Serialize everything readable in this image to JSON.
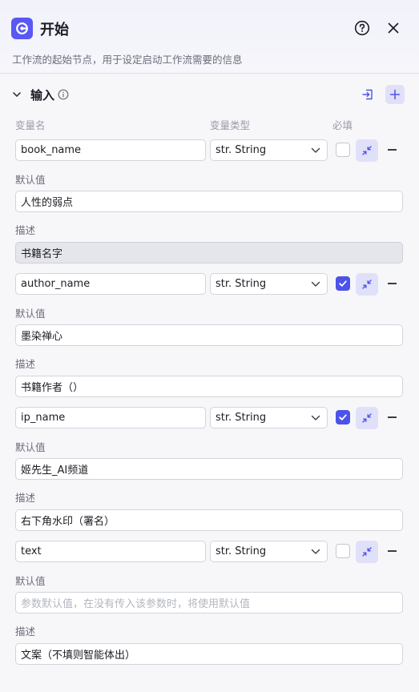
{
  "header": {
    "title": "开始",
    "subtitle": "工作流的起始节点，用于设定启动工作流需要的信息",
    "logo_icon": "start-node-icon",
    "help_icon": "help-circle-icon",
    "close_icon": "close-icon"
  },
  "section": {
    "title": "输入",
    "columns": {
      "name": "变量名",
      "type": "变量类型",
      "required": "必填"
    }
  },
  "labels": {
    "default": "默认值",
    "desc": "描述"
  },
  "accent_color": "#4d53e8",
  "variables": [
    {
      "name": "book_name",
      "type": "str. String",
      "required": false,
      "default": "人性的弱点",
      "default_placeholder": "",
      "desc": "书籍名字"
    },
    {
      "name": "author_name",
      "type": "str. String",
      "required": true,
      "default": "墨染禅心",
      "default_placeholder": "",
      "desc": "书籍作者（）"
    },
    {
      "name": "ip_name",
      "type": "str. String",
      "required": true,
      "default": "姬先生_AI频道",
      "default_placeholder": "",
      "desc": "右下角水印（署名）"
    },
    {
      "name": "text",
      "type": "str. String",
      "required": false,
      "default": "",
      "default_placeholder": "参数默认值，在没有传入该参数时，将使用默认值",
      "desc": "文案（不填则智能体出）"
    }
  ]
}
